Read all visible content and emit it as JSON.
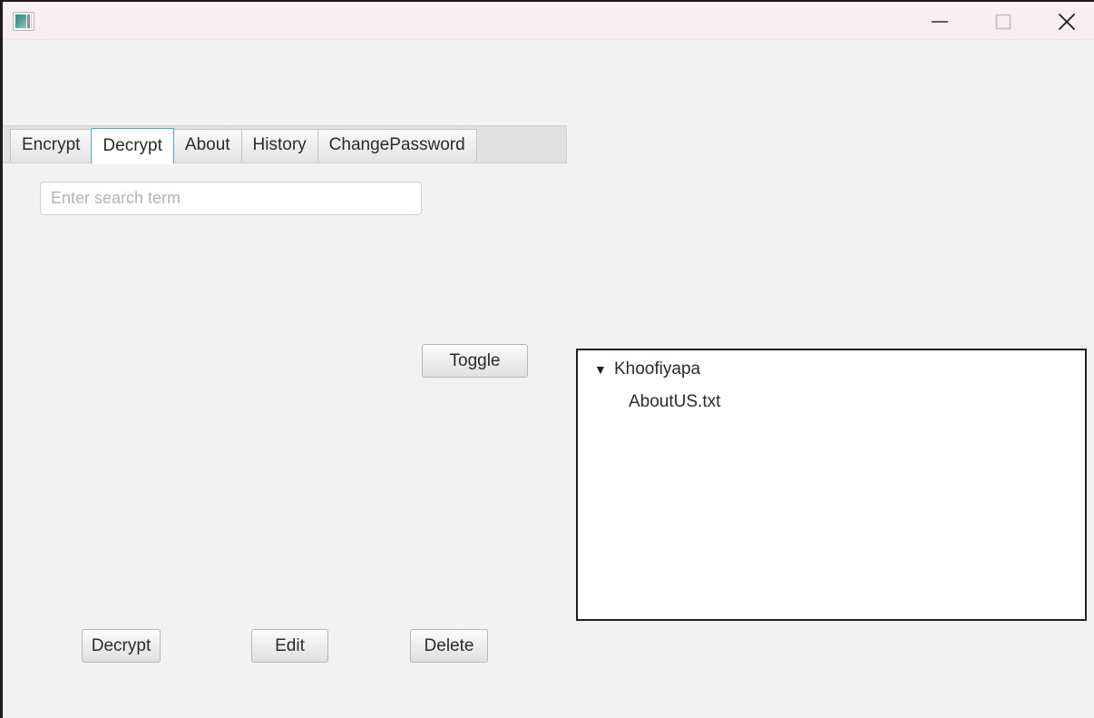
{
  "window": {
    "title": "",
    "icon": "app-icon",
    "controls": {
      "minimize": "—",
      "maximize": "□",
      "close": "✕"
    }
  },
  "tabs": [
    {
      "label": "Encrypt",
      "active": false
    },
    {
      "label": "Decrypt",
      "active": true
    },
    {
      "label": "About",
      "active": false
    },
    {
      "label": "History",
      "active": false
    },
    {
      "label": "ChangePassword",
      "active": false
    }
  ],
  "search": {
    "value": "",
    "placeholder": "Enter search term"
  },
  "buttons": {
    "toggle": "Toggle",
    "decrypt": "Decrypt",
    "edit": "Edit",
    "delete": "Delete"
  },
  "tree": {
    "expander": "▼",
    "root": "Khoofiyapa",
    "children": [
      {
        "label": "AboutUS.txt"
      }
    ]
  },
  "colors": {
    "titlebar": "#f8eef3",
    "accent": "#3daee9",
    "content_bg": "#f2f2f2",
    "tabstrip_bg": "#e2e2e2",
    "panel_border": "#1f1f1f",
    "icon_teal": "#2e8b7f"
  }
}
